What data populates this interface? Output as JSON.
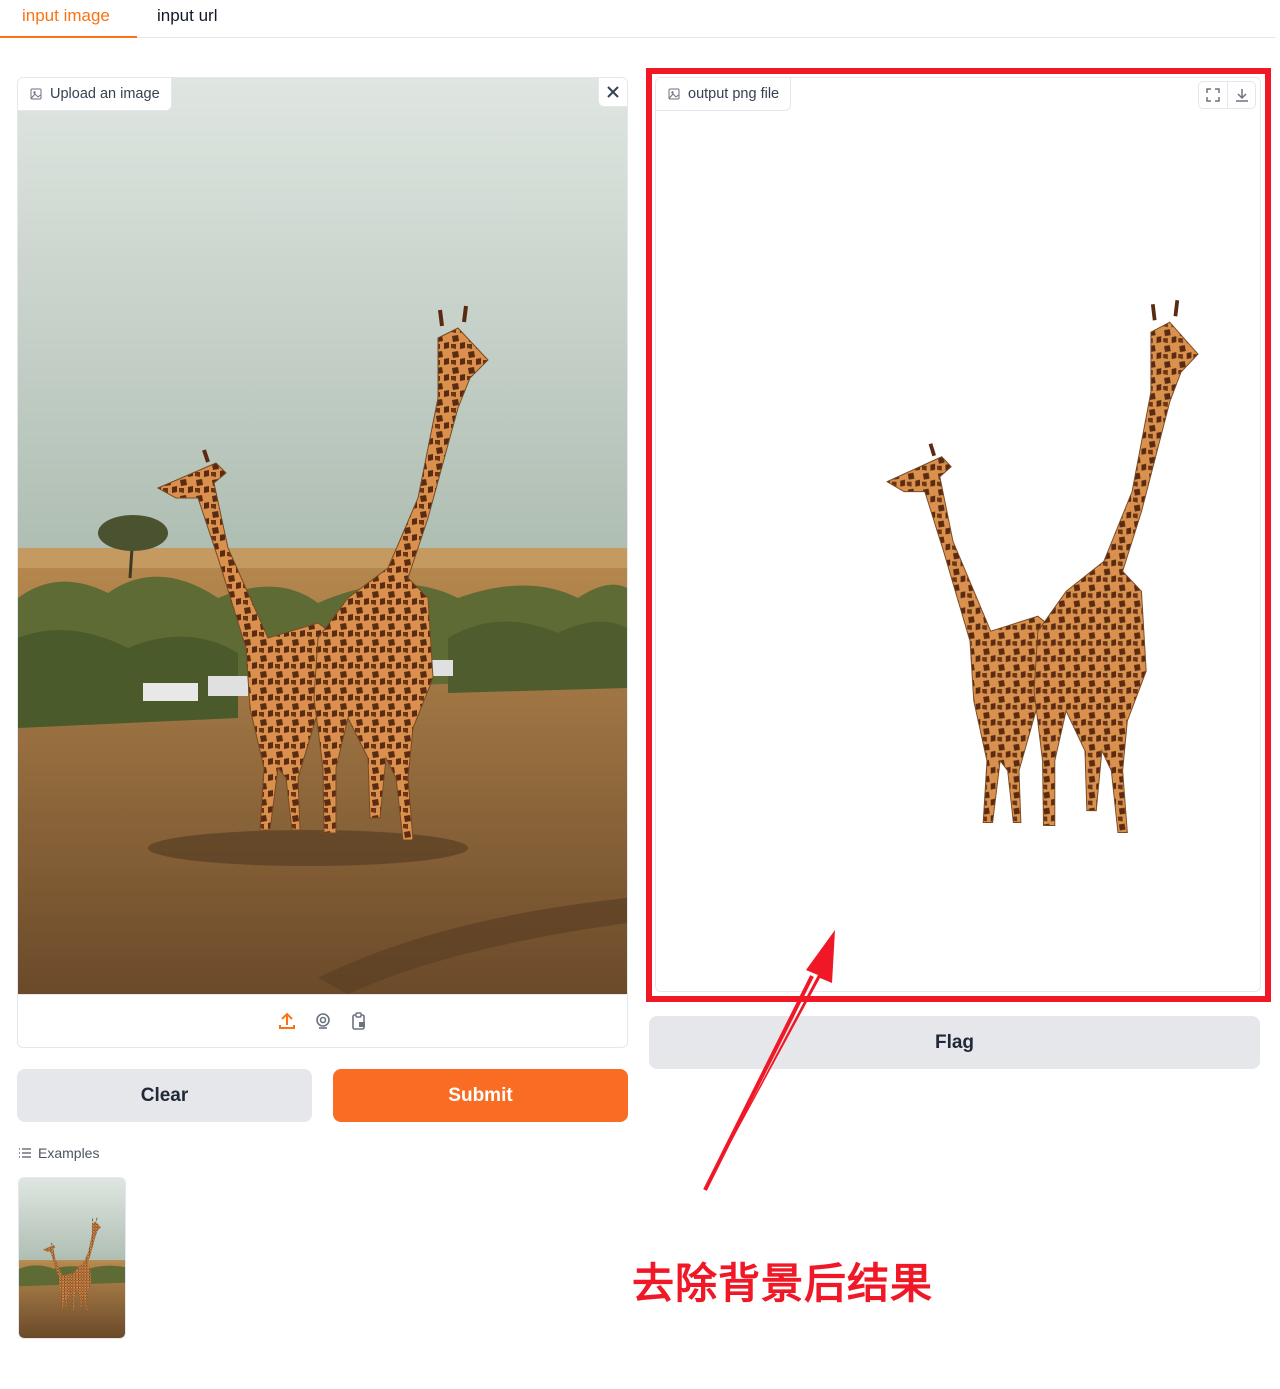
{
  "tabs": [
    {
      "label": "input image",
      "active": true
    },
    {
      "label": "input url",
      "active": false
    }
  ],
  "input_panel": {
    "label": "Upload an image",
    "close_icon": "close-icon",
    "source_icons": [
      "upload-icon",
      "webcam-icon",
      "clipboard-icon"
    ]
  },
  "output_panel": {
    "label": "output png file",
    "tool_icons": [
      "fullscreen-icon",
      "download-icon"
    ]
  },
  "buttons": {
    "clear": "Clear",
    "submit": "Submit",
    "flag": "Flag"
  },
  "examples": {
    "label": "Examples"
  },
  "annotation": {
    "text": "去除背景后结果"
  },
  "colors": {
    "accent": "#f97316",
    "submit_bg": "#f86c23",
    "highlight": "#f01826",
    "secondary_btn": "#e5e7eb"
  }
}
